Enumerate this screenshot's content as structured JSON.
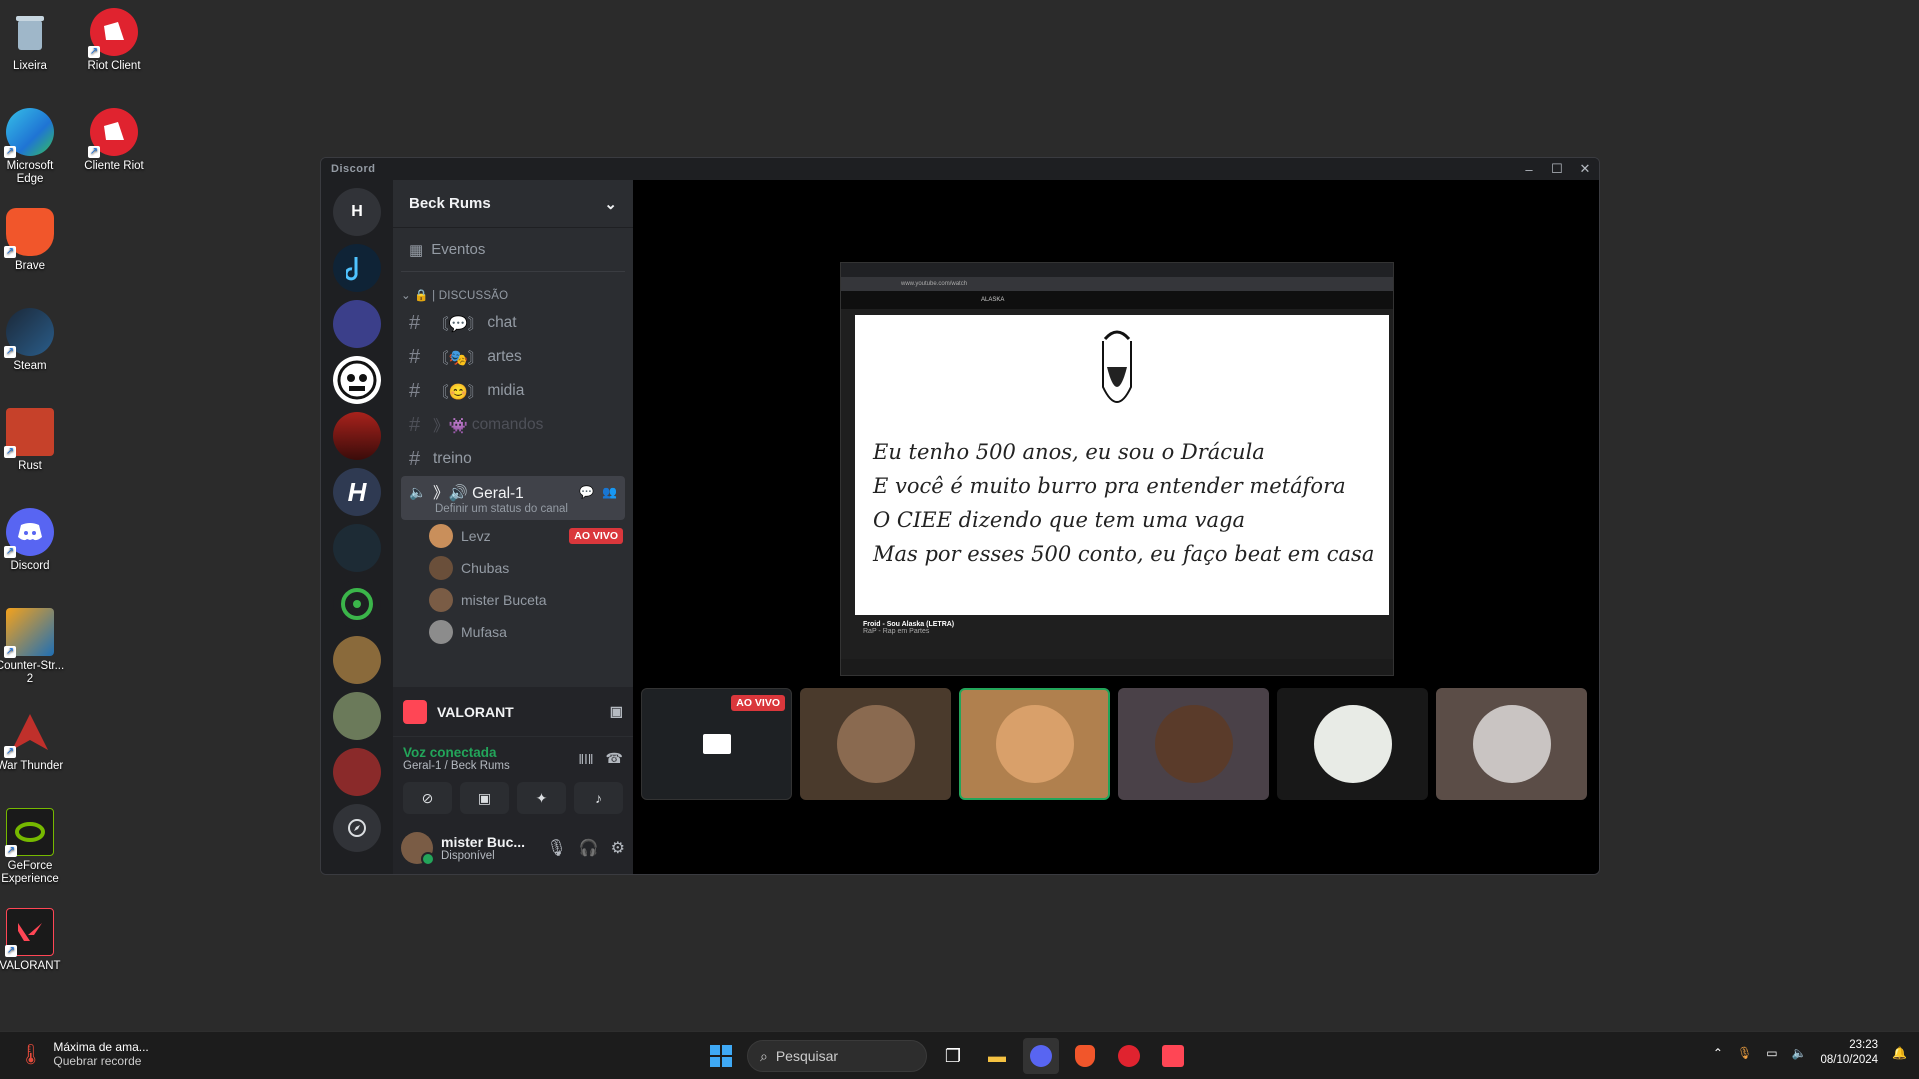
{
  "desktop": {
    "icons": [
      {
        "label": "Lixeira"
      },
      {
        "label": "Riot Client"
      },
      {
        "label": "Microsoft Edge"
      },
      {
        "label": "Cliente Riot"
      },
      {
        "label": "Brave"
      },
      {
        "label": "Steam"
      },
      {
        "label": "Rust"
      },
      {
        "label": "Discord"
      },
      {
        "label": "Counter-Str... 2"
      },
      {
        "label": "War Thunder"
      },
      {
        "label": "GeForce Experience"
      },
      {
        "label": "VALORANT"
      }
    ]
  },
  "window": {
    "title": "Discord",
    "minimize": "–",
    "maximize": "☐",
    "close": "✕"
  },
  "guilds": {
    "home_initial": "H"
  },
  "server": {
    "name": "Beck Rums",
    "chevron": "⌄",
    "events_label": "Eventos",
    "category": "| DISCUSSÃO",
    "channels": [
      {
        "prefix": "〘💬〙",
        "name": "chat"
      },
      {
        "prefix": "〘🎭〙",
        "name": "artes"
      },
      {
        "prefix": "〘😊〙",
        "name": "midia"
      },
      {
        "prefix": "》👾",
        "name": "comandos"
      },
      {
        "prefix": "",
        "name": "treino"
      }
    ],
    "voice_channel": {
      "name": "》🔊 Geral-1",
      "status": "Definir um status do canal"
    },
    "voice_users": [
      {
        "name": "Levz",
        "badge": "AO VIVO"
      },
      {
        "name": "Chubas"
      },
      {
        "name": "mister Buceta"
      },
      {
        "name": "Mufasa"
      }
    ]
  },
  "activity": {
    "name": "VALORANT"
  },
  "voice_connection": {
    "title": "Voz conectada",
    "subtitle": "Geral-1 / Beck Rums"
  },
  "user": {
    "name": "mister Buc...",
    "status": "Disponível"
  },
  "stream": {
    "url": "www.youtube.com/watch",
    "search": "ALASKA",
    "lyrics": [
      "Eu tenho 500 anos, eu sou o Drácula",
      "E você é muito burro pra entender metáfora",
      "O CIEE dizendo que tem uma vaga",
      "Mas por esses 500 conto, eu faço beat em casa"
    ],
    "video_title": "Froid - Sou Alaska (LETRA)",
    "channel": "RaP - Rap em Partes"
  },
  "tiles": {
    "live_badge": "AO VIVO"
  },
  "taskbar": {
    "weather_title": "Máxima de ama...",
    "weather_sub": "Quebrar recorde",
    "search_placeholder": "Pesquisar",
    "time": "23:23",
    "date": "08/10/2024"
  }
}
